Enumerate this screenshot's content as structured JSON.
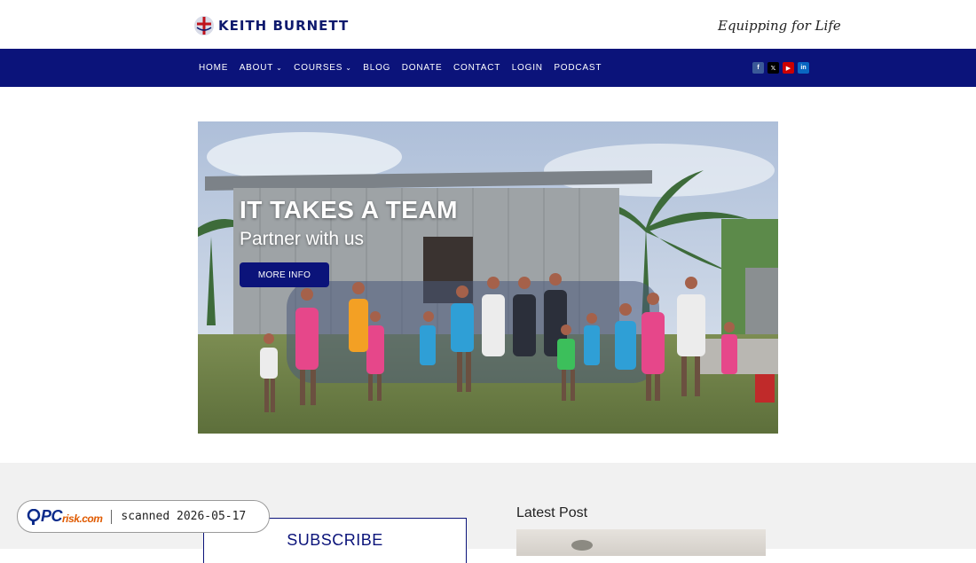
{
  "brand": {
    "name": "KEITH BURNETT",
    "tagline": "Equipping for Life"
  },
  "nav": {
    "items": [
      {
        "label": "HOME",
        "has_dropdown": false
      },
      {
        "label": "ABOUT",
        "has_dropdown": true
      },
      {
        "label": "COURSES",
        "has_dropdown": true
      },
      {
        "label": "BLOG",
        "has_dropdown": false
      },
      {
        "label": "DONATE",
        "has_dropdown": false
      },
      {
        "label": "CONTACT",
        "has_dropdown": false
      },
      {
        "label": "LOGIN",
        "has_dropdown": false
      },
      {
        "label": "PODCAST",
        "has_dropdown": false
      }
    ],
    "social": [
      {
        "name": "facebook-icon",
        "glyph": "f"
      },
      {
        "name": "x-icon",
        "glyph": "𝕏"
      },
      {
        "name": "youtube-icon",
        "glyph": "▶"
      },
      {
        "name": "linkedin-icon",
        "glyph": "in"
      }
    ]
  },
  "hero": {
    "title": "IT TAKES A TEAM",
    "subtitle": "Partner with us",
    "button_label": "MORE INFO"
  },
  "subscribe": {
    "title": "SUBSCRIBE"
  },
  "latest": {
    "title": "Latest Post"
  },
  "badge": {
    "logo_main": "PC",
    "logo_small": "risk.com",
    "text": "scanned 2026-05-17"
  },
  "colors": {
    "brand_navy": "#0b137a",
    "footer_bg": "#f1f1f1",
    "white": "#ffffff"
  }
}
